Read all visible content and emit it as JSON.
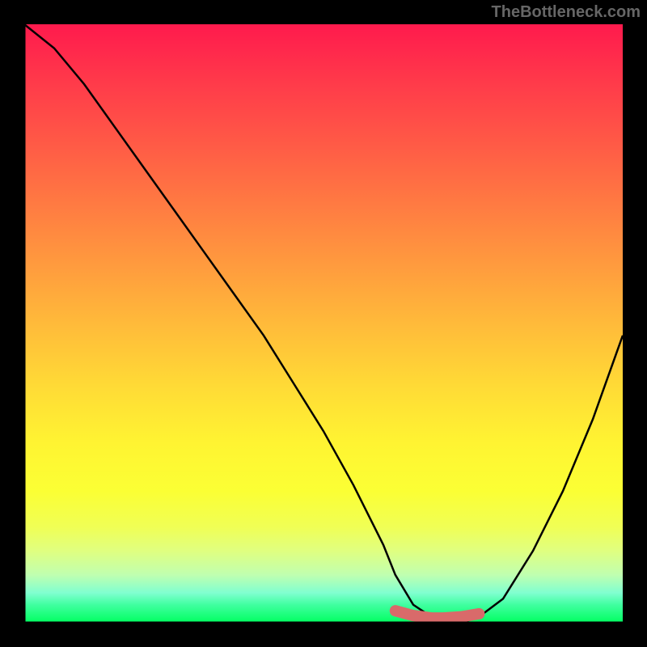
{
  "watermark": "TheBottleneck.com",
  "chart_data": {
    "type": "line",
    "title": "",
    "xlabel": "",
    "ylabel": "",
    "xlim": [
      0,
      100
    ],
    "ylim": [
      0,
      100
    ],
    "series": [
      {
        "name": "curve",
        "x": [
          0,
          5,
          10,
          15,
          20,
          25,
          30,
          35,
          40,
          45,
          50,
          55,
          60,
          62,
          65,
          68,
          70,
          73,
          76,
          80,
          85,
          90,
          95,
          100
        ],
        "values": [
          100,
          96,
          90,
          83,
          76,
          69,
          62,
          55,
          48,
          40,
          32,
          23,
          13,
          8,
          3,
          1,
          0,
          0,
          1,
          4,
          12,
          22,
          34,
          48
        ]
      },
      {
        "name": "highlight",
        "x": [
          62,
          65,
          68,
          70,
          73,
          76
        ],
        "values": [
          2,
          1.2,
          0.8,
          0.8,
          1.0,
          1.5
        ]
      }
    ],
    "colors": {
      "curve": "#000000",
      "highlight": "#d96a6a"
    }
  }
}
